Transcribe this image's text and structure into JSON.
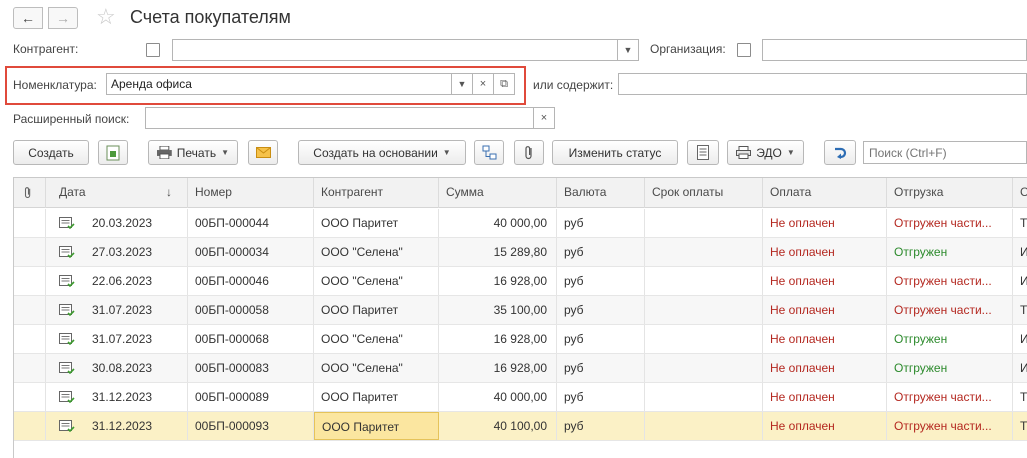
{
  "header": {
    "title": "Счета покупателям",
    "back_icon": "arrow-left-icon",
    "forward_icon": "arrow-right-icon",
    "favorite_icon": "star-icon"
  },
  "filters": {
    "counterparty_label": "Контрагент:",
    "organization_label": "Организация:",
    "nomenclature_label": "Номенклатура:",
    "nomenclature_value": "Аренда офиса",
    "or_contains_label": "или содержит:",
    "extended_search_label": "Расширенный поиск:"
  },
  "toolbar": {
    "create_label": "Создать",
    "print_label": "Печать",
    "create_based_on_label": "Создать на основании",
    "change_status_label": "Изменить статус",
    "edo_label": "ЭДО",
    "search_placeholder": "Поиск (Ctrl+F)"
  },
  "table": {
    "columns": [
      "Дата",
      "Номер",
      "Контрагент",
      "Сумма",
      "Валюта",
      "Срок оплаты",
      "Оплата",
      "Отгрузка",
      "С"
    ],
    "rows": [
      {
        "date": "20.03.2023",
        "number": "00БП-000044",
        "counterparty": "ООО Паритет",
        "amount": "40 000,00",
        "currency": "руб",
        "due": "",
        "payment": "Не оплачен",
        "shipment": "Отгружен части...",
        "extra": "Т",
        "ship_status": "partial"
      },
      {
        "date": "27.03.2023",
        "number": "00БП-000034",
        "counterparty": "ООО \"Селена\"",
        "amount": "15 289,80",
        "currency": "руб",
        "due": "",
        "payment": "Не оплачен",
        "shipment": "Отгружен",
        "extra": "И",
        "ship_status": "full"
      },
      {
        "date": "22.06.2023",
        "number": "00БП-000046",
        "counterparty": "ООО \"Селена\"",
        "amount": "16 928,00",
        "currency": "руб",
        "due": "",
        "payment": "Не оплачен",
        "shipment": "Отгружен части...",
        "extra": "И",
        "ship_status": "partial"
      },
      {
        "date": "31.07.2023",
        "number": "00БП-000058",
        "counterparty": "ООО Паритет",
        "amount": "35 100,00",
        "currency": "руб",
        "due": "",
        "payment": "Не оплачен",
        "shipment": "Отгружен части...",
        "extra": "Т",
        "ship_status": "partial"
      },
      {
        "date": "31.07.2023",
        "number": "00БП-000068",
        "counterparty": "ООО \"Селена\"",
        "amount": "16 928,00",
        "currency": "руб",
        "due": "",
        "payment": "Не оплачен",
        "shipment": "Отгружен",
        "extra": "И",
        "ship_status": "full"
      },
      {
        "date": "30.08.2023",
        "number": "00БП-000083",
        "counterparty": "ООО \"Селена\"",
        "amount": "16 928,00",
        "currency": "руб",
        "due": "",
        "payment": "Не оплачен",
        "shipment": "Отгружен",
        "extra": "И",
        "ship_status": "full"
      },
      {
        "date": "31.12.2023",
        "number": "00БП-000089",
        "counterparty": "ООО Паритет",
        "amount": "40 000,00",
        "currency": "руб",
        "due": "",
        "payment": "Не оплачен",
        "shipment": "Отгружен части...",
        "extra": "Т",
        "ship_status": "partial"
      },
      {
        "date": "31.12.2023",
        "number": "00БП-000093",
        "counterparty": "ООО Паритет",
        "amount": "40 100,00",
        "currency": "руб",
        "due": "",
        "payment": "Не оплачен",
        "shipment": "Отгружен части...",
        "extra": "Т",
        "ship_status": "partial"
      }
    ]
  },
  "colors": {
    "unpaid": "#b42820",
    "shipped": "#2c8a2c",
    "selected_row": "#fbf1c6",
    "highlight_frame": "#e04a3b"
  }
}
